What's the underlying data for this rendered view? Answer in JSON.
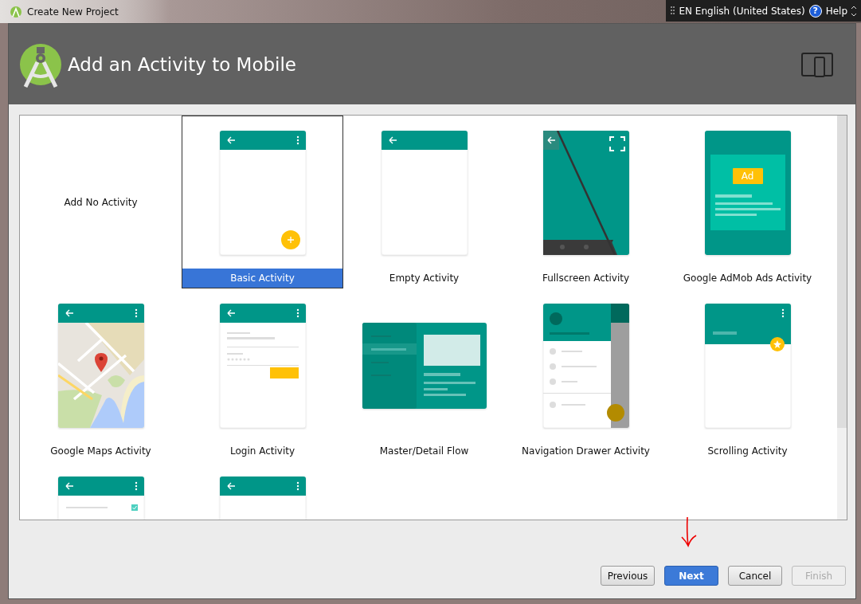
{
  "window": {
    "title": "Create New Project"
  },
  "language_bar": {
    "language": "EN English (United States)",
    "help_glyph": "?",
    "help": "Help"
  },
  "header": {
    "title": "Add an Activity to Mobile"
  },
  "templates": [
    {
      "label": "Add No Activity",
      "kind": "none",
      "selected": false
    },
    {
      "label": "Basic Activity",
      "kind": "basic",
      "selected": true
    },
    {
      "label": "Empty Activity",
      "kind": "empty",
      "selected": false
    },
    {
      "label": "Fullscreen Activity",
      "kind": "fullscreen",
      "selected": false
    },
    {
      "label": "Google AdMob Ads Activity",
      "kind": "admob",
      "selected": false,
      "badge": "Ad"
    },
    {
      "label": "Google Maps Activity",
      "kind": "maps",
      "selected": false
    },
    {
      "label": "Login Activity",
      "kind": "login",
      "selected": false
    },
    {
      "label": "Master/Detail Flow",
      "kind": "master",
      "selected": false
    },
    {
      "label": "Navigation Drawer Activity",
      "kind": "drawer",
      "selected": false
    },
    {
      "label": "Scrolling Activity",
      "kind": "scrolling",
      "selected": false
    },
    {
      "kind": "settings",
      "selected": false
    },
    {
      "kind": "tabbed",
      "selected": false
    }
  ],
  "buttons": [
    {
      "label": "Previous",
      "primary": false,
      "disabled": false
    },
    {
      "label": "Next",
      "primary": true,
      "disabled": false
    },
    {
      "label": "Cancel",
      "primary": false,
      "disabled": false
    },
    {
      "label": "Finish",
      "primary": false,
      "disabled": true
    }
  ]
}
